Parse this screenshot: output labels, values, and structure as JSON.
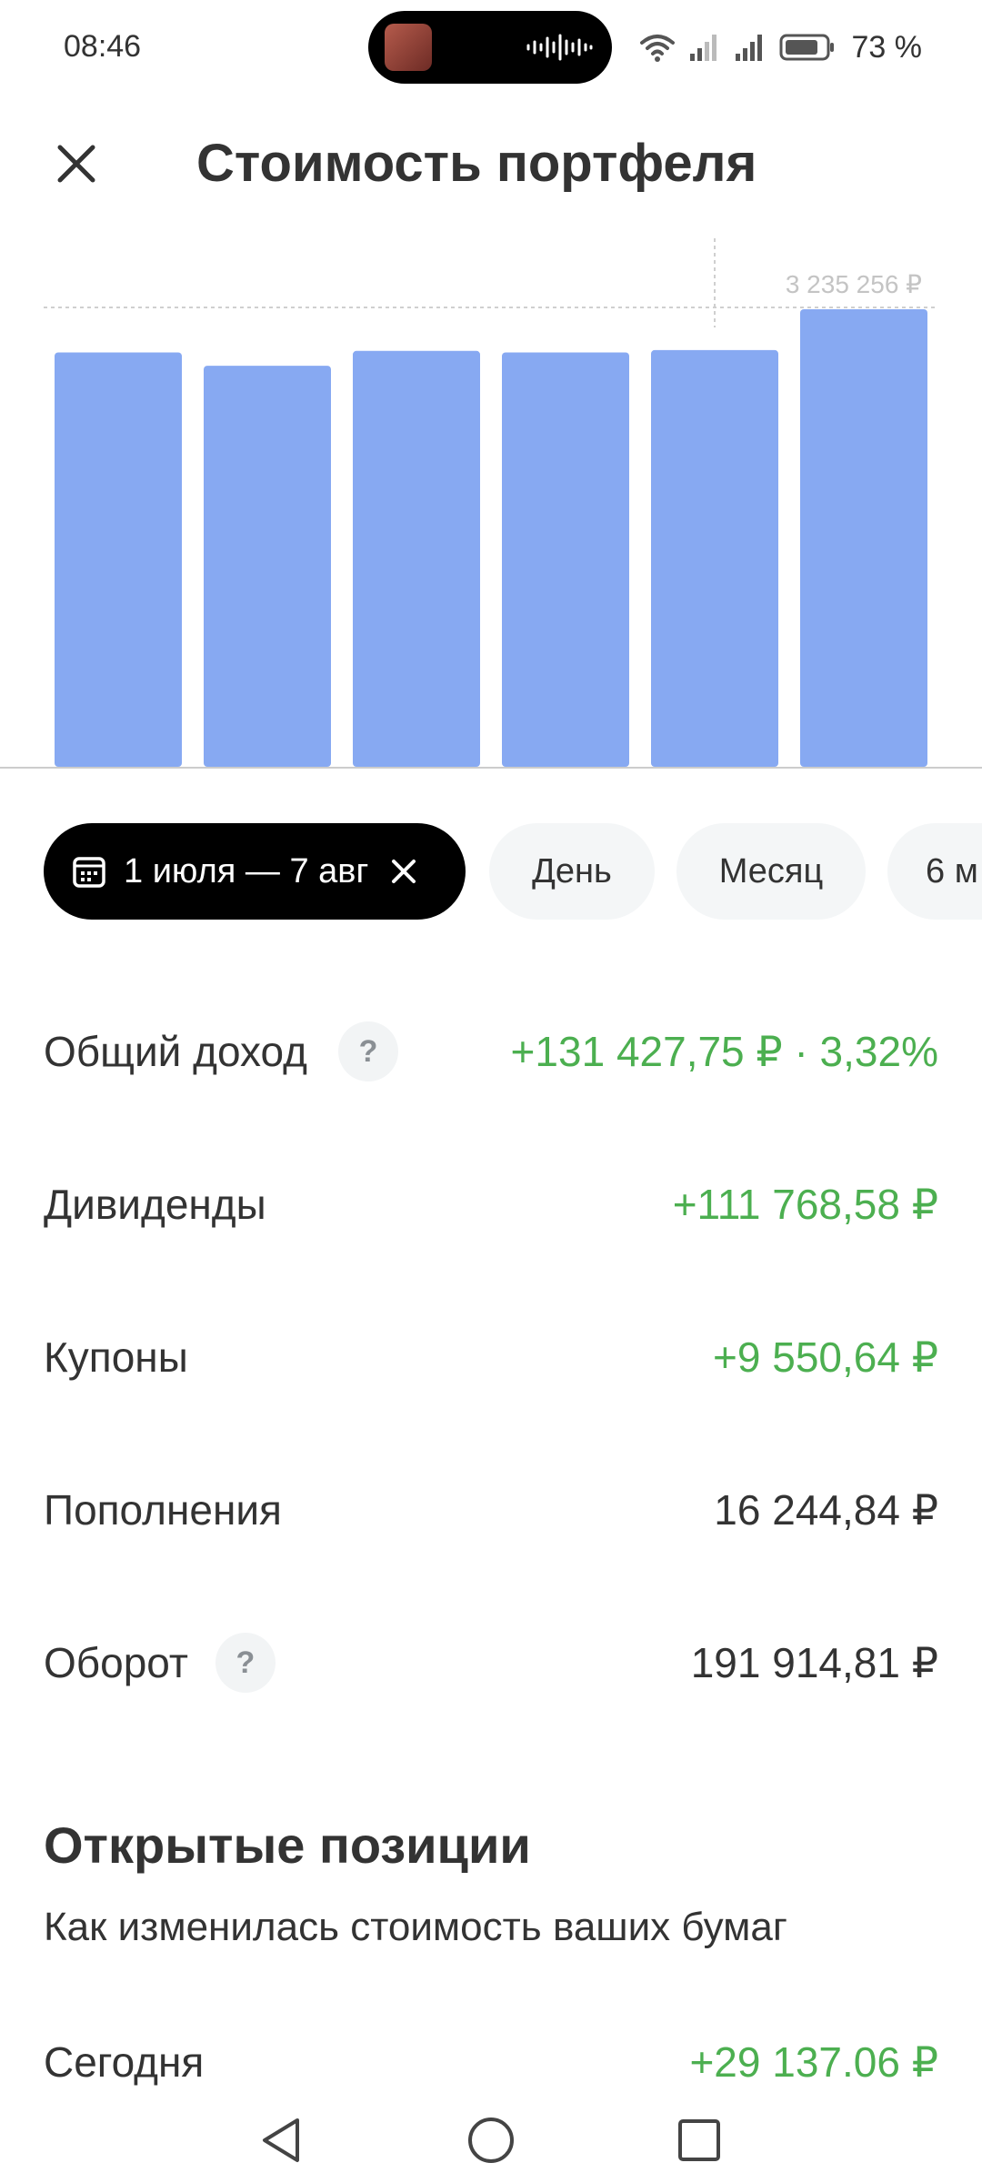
{
  "status_bar": {
    "time": "08:46",
    "battery_percent": "73 %",
    "icons": [
      "media-thumbnail-icon",
      "audio-wave-icon",
      "wifi-icon",
      "signal-icon",
      "signal-icon",
      "battery-icon"
    ]
  },
  "header": {
    "title": "Стоимость портфеля",
    "close_icon": "close-icon"
  },
  "chart_data": {
    "type": "bar",
    "bar_color": "#87a9f2",
    "categories": [
      "",
      "",
      "",
      "",
      "",
      ""
    ],
    "values": [
      3180000,
      3163000,
      3182000,
      3180000,
      3183000,
      3235256
    ],
    "ylim": [
      2650000,
      3235256
    ],
    "max_label": "3 235 256 ₽",
    "reference_line": "dashed at max value",
    "grid": false
  },
  "periods": {
    "selected_range": "1 июля — 7 авг",
    "chips": [
      "День",
      "Месяц",
      "6 м"
    ]
  },
  "metrics": [
    {
      "label": "Общий доход",
      "value": "+131 427,75 ₽ · 3,32%",
      "positive": true,
      "help": true
    },
    {
      "label": "Дивиденды",
      "value": "+111 768,58 ₽",
      "positive": true,
      "help": false
    },
    {
      "label": "Купоны",
      "value": "+9 550,64 ₽",
      "positive": true,
      "help": false
    },
    {
      "label": "Пополнения",
      "value": "16 244,84 ₽",
      "positive": false,
      "help": false
    },
    {
      "label": "Оборот",
      "value": "191 914,81 ₽",
      "positive": false,
      "help": true
    }
  ],
  "help_glyph": "?",
  "open_positions": {
    "title": "Открытые позиции",
    "subtitle": "Как изменилась стоимость ваших бумаг",
    "today_label": "Сегодня",
    "today_value": "+29 137.06 ₽"
  },
  "colors": {
    "positive": "#4caf50",
    "bar": "#87a9f2",
    "chip_active_bg": "#000000",
    "chip_bg": "#f4f6f7"
  }
}
